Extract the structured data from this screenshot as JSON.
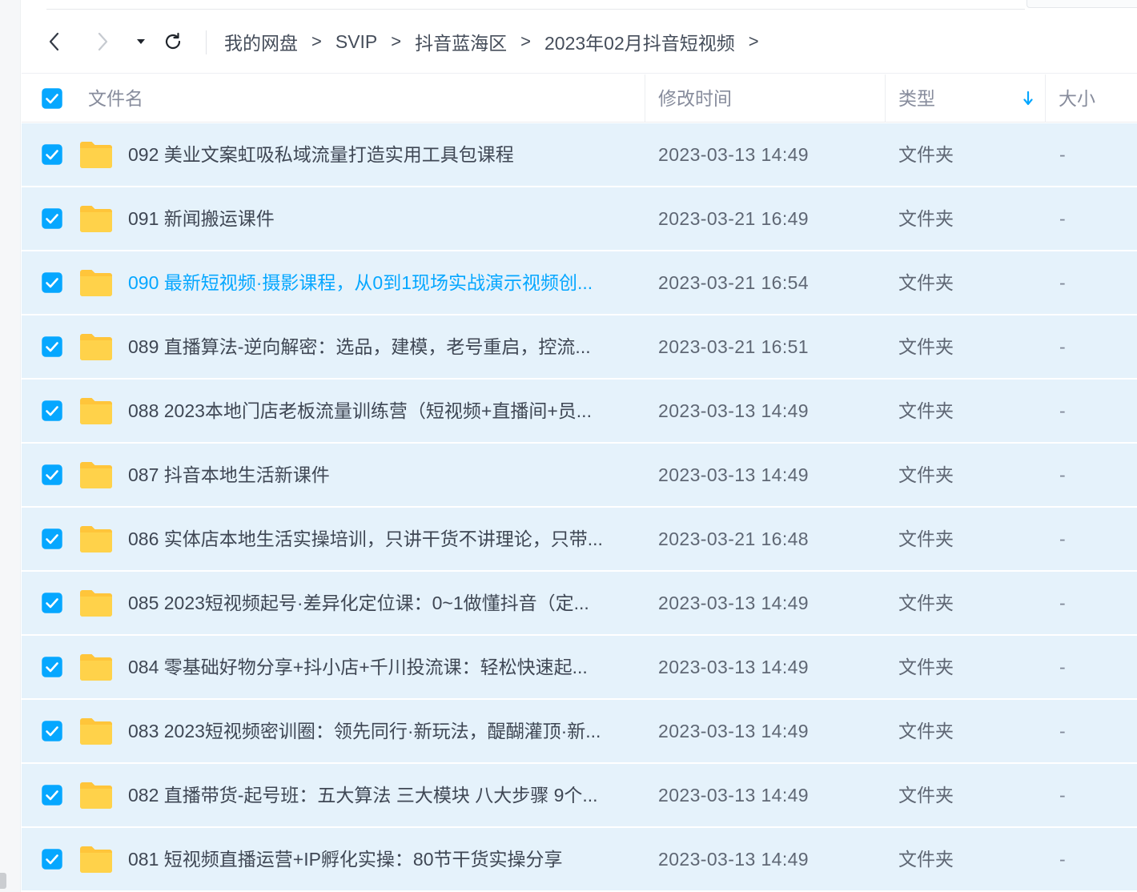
{
  "nav": {
    "back_icon": "chevron-left-icon",
    "forward_icon": "chevron-right-icon",
    "history_icon": "caret-down-icon",
    "refresh_icon": "refresh-icon",
    "forward_disabled": true
  },
  "breadcrumb": {
    "items": [
      "我的网盘",
      "SVIP",
      "抖音蓝海区",
      "2023年02月抖音短视频"
    ],
    "separator": ">"
  },
  "table": {
    "columns": {
      "name": "文件名",
      "modified": "修改时间",
      "type": "类型",
      "size": "大小"
    },
    "sort_icon": "arrow-down-icon",
    "select_all_checked": true,
    "rows": [
      {
        "name": "092 美业文案虹吸私域流量打造实用工具包课程",
        "modified": "2023-03-13 14:49",
        "type": "文件夹",
        "size": "-",
        "checked": true,
        "icon": "folder-icon"
      },
      {
        "name": "091 新闻搬运课件",
        "modified": "2023-03-21 16:49",
        "type": "文件夹",
        "size": "-",
        "checked": true,
        "icon": "folder-icon"
      },
      {
        "name": "090 最新短视频·摄影课程，从0到1现场实战演示视频创...",
        "modified": "2023-03-21 16:54",
        "type": "文件夹",
        "size": "-",
        "checked": true,
        "icon": "folder-icon",
        "hovered": true
      },
      {
        "name": "089 直播算法-逆向解密：选品，建模，老号重启，控流...",
        "modified": "2023-03-21 16:51",
        "type": "文件夹",
        "size": "-",
        "checked": true,
        "icon": "folder-icon"
      },
      {
        "name": "088 2023本地门店老板流量训练营（短视频+直播间+员...",
        "modified": "2023-03-13 14:49",
        "type": "文件夹",
        "size": "-",
        "checked": true,
        "icon": "folder-icon"
      },
      {
        "name": "087 抖音本地生活新课件",
        "modified": "2023-03-13 14:49",
        "type": "文件夹",
        "size": "-",
        "checked": true,
        "icon": "folder-icon"
      },
      {
        "name": "086 实体店本地生活实操培训，只讲干货不讲理论，只带...",
        "modified": "2023-03-21 16:48",
        "type": "文件夹",
        "size": "-",
        "checked": true,
        "icon": "folder-icon"
      },
      {
        "name": "085 2023短视频起号·差异化定位课：0~1做懂抖音（定...",
        "modified": "2023-03-13 14:49",
        "type": "文件夹",
        "size": "-",
        "checked": true,
        "icon": "folder-icon"
      },
      {
        "name": "084 零基础好物分享+抖小店+千川投流课：轻松快速起...",
        "modified": "2023-03-13 14:49",
        "type": "文件夹",
        "size": "-",
        "checked": true,
        "icon": "folder-icon"
      },
      {
        "name": "083 2023短视频密训圈：领先同行·新玩法，醍醐灌顶·新...",
        "modified": "2023-03-13 14:49",
        "type": "文件夹",
        "size": "-",
        "checked": true,
        "icon": "folder-icon"
      },
      {
        "name": "082 直播带货-起号班：五大算法 三大模块 八大步骤 9个...",
        "modified": "2023-03-13 14:49",
        "type": "文件夹",
        "size": "-",
        "checked": true,
        "icon": "folder-icon"
      },
      {
        "name": "081 短视频直播运营+IP孵化实操：80节干货实操分享",
        "modified": "2023-03-13 14:49",
        "type": "文件夹",
        "size": "-",
        "checked": true,
        "icon": "folder-icon"
      }
    ]
  },
  "colors": {
    "accent": "#06a7ff",
    "selected_row": "#e5f2fb",
    "folder": "#ffd24a",
    "text": "#3f4754",
    "muted": "#878c9c"
  }
}
